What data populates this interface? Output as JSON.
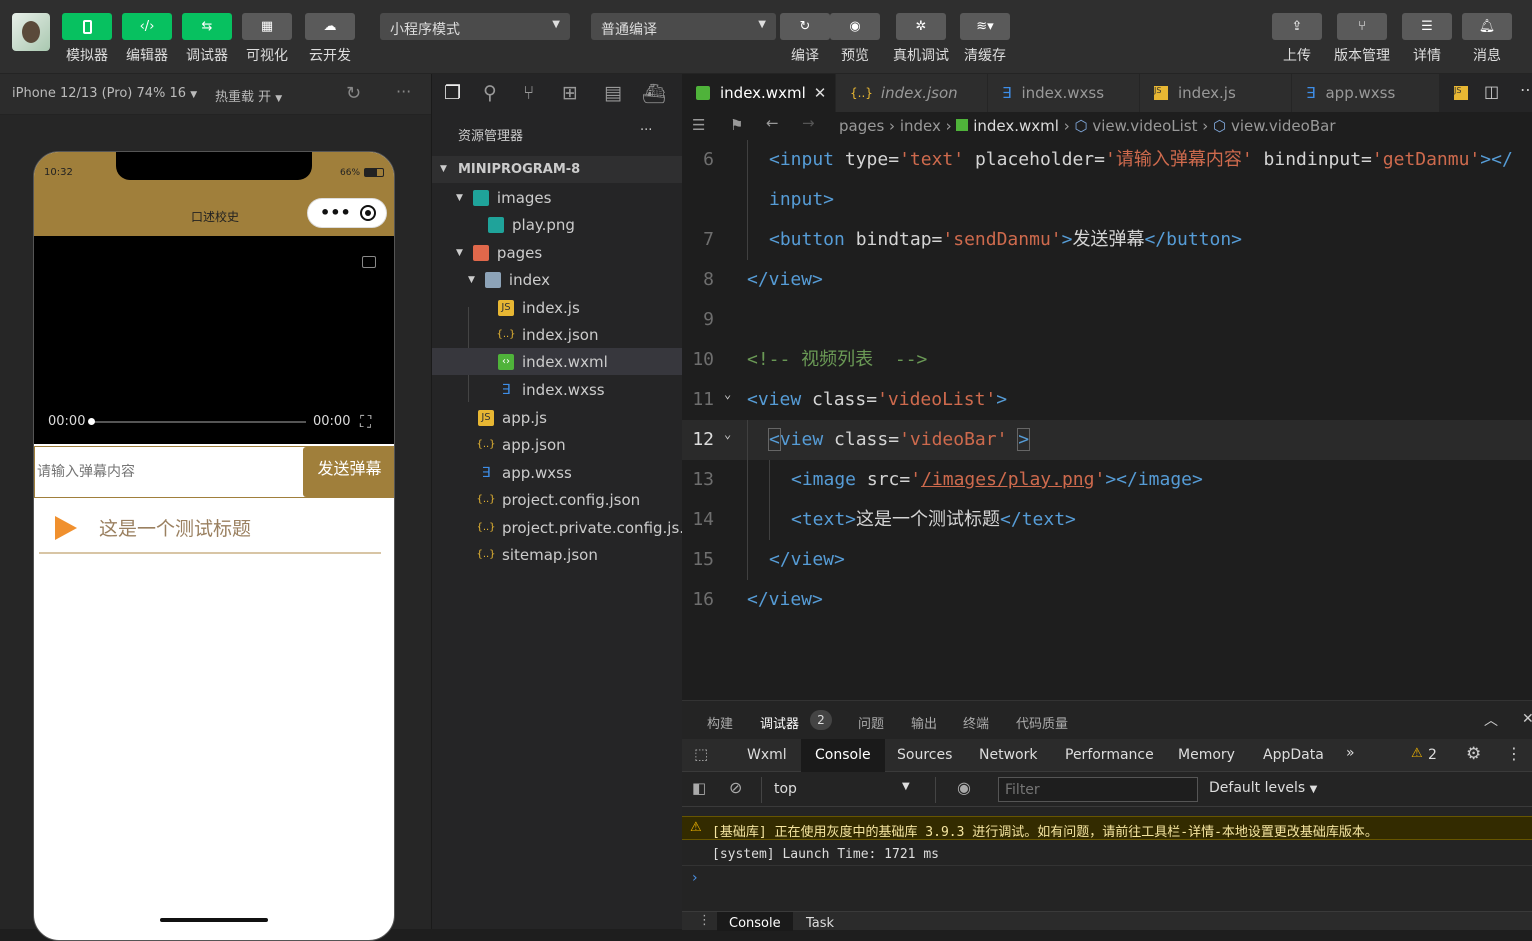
{
  "toolbar": {
    "left_buttons": [
      {
        "label": "模拟器",
        "icon": "phone-icon"
      },
      {
        "label": "编辑器",
        "icon": "code-icon"
      },
      {
        "label": "调试器",
        "icon": "debug-icon"
      },
      {
        "label": "可视化",
        "icon": "layout-icon"
      },
      {
        "label": "云开发",
        "icon": "cloud-icon"
      }
    ],
    "mode_select": "小程序模式",
    "compile_select": "普通编译",
    "mid_buttons": [
      {
        "label": "编译",
        "icon": "refresh-icon"
      },
      {
        "label": "预览",
        "icon": "eye-icon"
      },
      {
        "label": "真机调试",
        "icon": "bug-icon"
      },
      {
        "label": "清缓存",
        "icon": "layers-icon"
      }
    ],
    "right_buttons": [
      {
        "label": "上传",
        "icon": "upload-icon"
      },
      {
        "label": "版本管理",
        "icon": "branch-icon"
      },
      {
        "label": "详情",
        "icon": "menu-icon"
      },
      {
        "label": "消息",
        "icon": "bell-icon"
      }
    ]
  },
  "simbar": {
    "device": "iPhone 12/13 (Pro) 74% 16",
    "hotreload": "热重载 开"
  },
  "phone": {
    "time": "10:32",
    "battery": "66%",
    "nav_title": "口述校史",
    "video_time_start": "00:00",
    "video_time_end": "00:00",
    "input_placeholder": "请输入弹幕内容",
    "send_button": "发送弹幕",
    "video_item_title": "这是一个测试标题",
    "brand_color": "#a07f3b"
  },
  "explorer": {
    "header": "资源管理器",
    "more": "···",
    "project": "MINIPROGRAM-8",
    "items": [
      {
        "name": "images",
        "type": "folder"
      },
      {
        "name": "play.png",
        "type": "image"
      },
      {
        "name": "pages",
        "type": "folder"
      },
      {
        "name": "index",
        "type": "folder"
      },
      {
        "name": "index.js",
        "type": "js"
      },
      {
        "name": "index.json",
        "type": "json"
      },
      {
        "name": "index.wxml",
        "type": "wxml"
      },
      {
        "name": "index.wxss",
        "type": "wxss"
      },
      {
        "name": "app.js",
        "type": "js"
      },
      {
        "name": "app.json",
        "type": "json"
      },
      {
        "name": "app.wxss",
        "type": "wxss"
      },
      {
        "name": "project.config.json",
        "type": "json"
      },
      {
        "name": "project.private.config.js...",
        "type": "json"
      },
      {
        "name": "sitemap.json",
        "type": "json"
      }
    ]
  },
  "editor": {
    "tabs": [
      "index.wxml",
      "index.json",
      "index.wxss",
      "index.js",
      "app.wxss"
    ],
    "breadcrumb": [
      "pages",
      "index",
      "index.wxml",
      "view.videoList",
      "view.videoBar"
    ],
    "line_numbers": [
      "6",
      "",
      "7",
      "8",
      "9",
      "10",
      "11",
      "12",
      "13",
      "14",
      "15",
      "16"
    ]
  },
  "devtools": {
    "top_tabs": [
      "构建",
      "调试器",
      "问题",
      "输出",
      "终端",
      "代码质量"
    ],
    "debugger_badge": "2",
    "panels": [
      "Wxml",
      "Console",
      "Sources",
      "Network",
      "Performance",
      "Memory",
      "AppData"
    ],
    "warn_count": "2",
    "context": "top",
    "filter_placeholder": "Filter",
    "levels": "Default levels",
    "messages": [
      "[基础库] 正在使用灰度中的基础库 3.9.3 进行调试。如有问题，请前往工具栏-详情-本地设置更改基础库版本。",
      "[system] Launch Time: 1721 ms"
    ],
    "bottom_tabs": [
      "Console",
      "Task"
    ]
  }
}
